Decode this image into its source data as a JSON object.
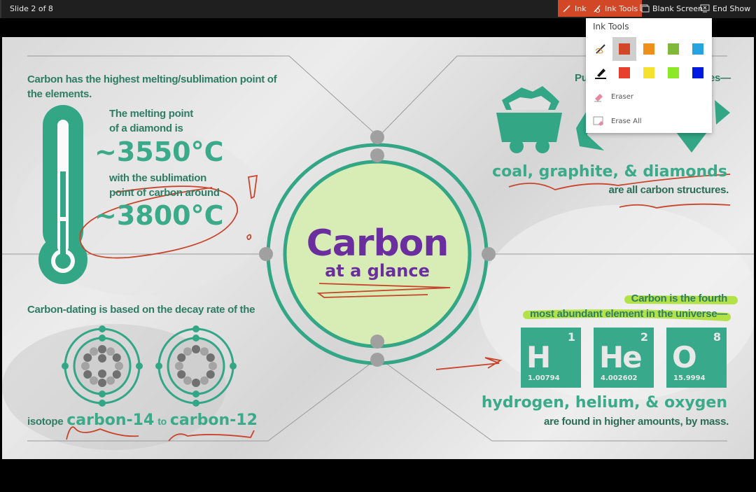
{
  "toolbar": {
    "slide_counter": "Slide 2 of 8",
    "ink_label": "Ink",
    "ink_tools_label": "Ink Tools",
    "blank_screen_label": "Blank Screen",
    "end_show_label": "End Show",
    "accent_color": "#d24726"
  },
  "ink_menu": {
    "title": "Ink Tools",
    "pen_colors": [
      "#d24726",
      "#f0901c",
      "#80b83a",
      "#27a4dd"
    ],
    "highlighter_colors": [
      "#e8402f",
      "#f5e130",
      "#8ee82a",
      "#0018e0"
    ],
    "selected_pen_color": "#d24726",
    "eraser_label": "Eraser",
    "erase_all_label": "Erase All"
  },
  "slide": {
    "title": "Carbon",
    "subtitle": "at a glance",
    "melting": {
      "intro": "Carbon has the highest melting/sublimation point of",
      "intro2": "the elements.",
      "diamond_line1": "The melting point",
      "diamond_line2": "of a diamond is",
      "diamond_temp": "~3550°C",
      "sublimation_line1": "with the sublimation",
      "sublimation_line2": "point of carbon around",
      "sublimation_temp": "~3800°C"
    },
    "structures": {
      "intro_left": "Pu",
      "intro_right": "es—",
      "heading": "coal, graphite, & diamonds",
      "caption": "are all carbon structures."
    },
    "dating": {
      "intro": "Carbon-dating is based on the decay rate of the",
      "prefix": "isotope",
      "isotope1": "carbon-14",
      "joiner": "to",
      "isotope2": "carbon-12"
    },
    "abundance": {
      "line1": "Carbon is the fourth",
      "line2": "most abundant element in the universe—",
      "elements": [
        {
          "symbol": "H",
          "number": "1",
          "mass": "1.00794"
        },
        {
          "symbol": "He",
          "number": "2",
          "mass": "4.002602"
        },
        {
          "symbol": "O",
          "number": "8",
          "mass": "15.9994"
        }
      ],
      "heading": "hydrogen, helium, & oxygen",
      "caption": "are found in higher amounts, by mass."
    }
  }
}
